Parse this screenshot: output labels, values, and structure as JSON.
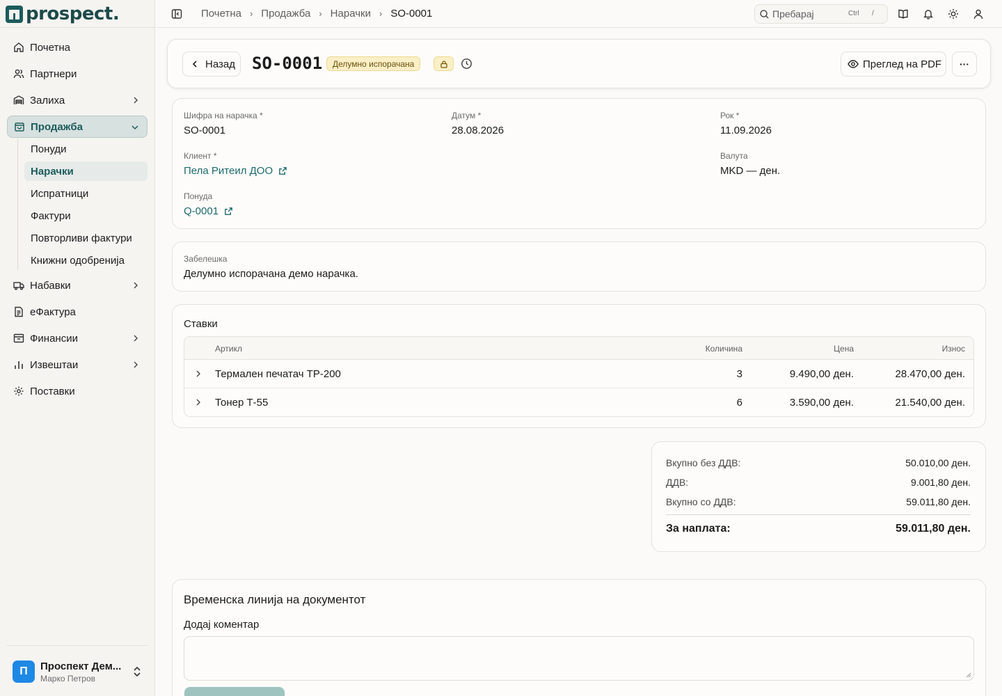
{
  "app": {
    "logo_text": "prospect."
  },
  "sidebar": {
    "items": [
      {
        "label": "Почетна",
        "icon": "home-icon"
      },
      {
        "label": "Партнери",
        "icon": "users-icon"
      },
      {
        "label": "Залиха",
        "icon": "warehouse-icon"
      },
      {
        "label": "Продажба",
        "icon": "shopping-bag-icon"
      },
      {
        "label": "Набавки",
        "icon": "truck-icon"
      },
      {
        "label": "еФактура",
        "icon": "document-icon"
      },
      {
        "label": "Финансии",
        "icon": "archive-icon"
      },
      {
        "label": "Извештаи",
        "icon": "bar-chart-icon"
      },
      {
        "label": "Поставки",
        "icon": "gear-icon"
      }
    ],
    "sales_sub": [
      "Понуди",
      "Нарачки",
      "Испратници",
      "Фактури",
      "Повторливи фактури",
      "Книжни одобренија"
    ],
    "user": {
      "avatar": "П",
      "name": "Проспект Дем...",
      "sub": "Марко Петров"
    }
  },
  "topbar": {
    "breadcrumbs": [
      "Почетна",
      "Продажба",
      "Нарачки",
      "SO-0001"
    ],
    "search_placeholder": "Пребарај",
    "kbd_ctrl": "Ctrl",
    "kbd_slash": "/"
  },
  "header": {
    "back_label": "Назад",
    "title": "SO-0001",
    "status": "Делумно испорачана",
    "pdf_label": "Преглед на PDF",
    "more_label": "···"
  },
  "info": {
    "order_code_label": "Шифра на нарачка *",
    "order_code": "SO-0001",
    "date_label": "Датум *",
    "date": "28.08.2026",
    "due_label": "Рок *",
    "due": "11.09.2026",
    "client_label": "Клиент *",
    "client": "Пела Ритеил ДОО",
    "currency_label": "Валута",
    "currency": "MKD — ден.",
    "quote_label": "Понуда",
    "quote": "Q-0001"
  },
  "note": {
    "label": "Забелешка",
    "text": "Делумно испорачана демо нарачка."
  },
  "items": {
    "title": "Ставки",
    "columns": {
      "article": "Артикл",
      "qty": "Количина",
      "price": "Цена",
      "amount": "Износ"
    },
    "rows": [
      {
        "article": "Термален печатач TP-200",
        "qty": "3",
        "price": "9.490,00 ден.",
        "amount": "28.470,00 ден."
      },
      {
        "article": "Тонер Т-55",
        "qty": "6",
        "price": "3.590,00 ден.",
        "amount": "21.540,00 ден."
      }
    ]
  },
  "totals": {
    "net_label": "Вкупно без ДДВ:",
    "net": "50.010,00 ден.",
    "vat_label": "ДДВ:",
    "vat": "9.001,80 ден.",
    "gross_label": "Вкупно со ДДВ:",
    "gross": "59.011,80 ден.",
    "due_label": "За наплата:",
    "due": "59.011,80 ден."
  },
  "timeline": {
    "title": "Временска линија на документот",
    "comment_label": "Додај коментар"
  }
}
